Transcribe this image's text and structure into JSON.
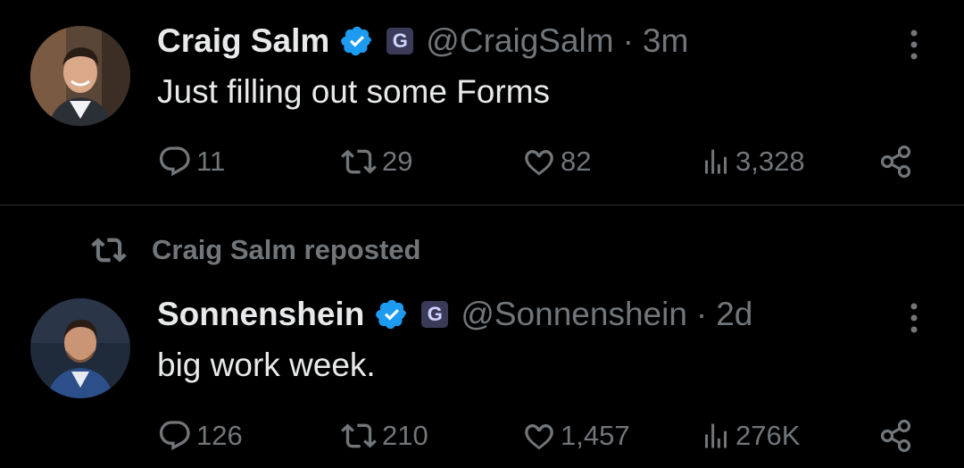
{
  "tweets": [
    {
      "name": "Craig Salm",
      "handle": "@CraigSalm",
      "dot": "·",
      "time": "3m",
      "text": "Just filling out some Forms",
      "replies": "11",
      "reposts": "29",
      "likes": "82",
      "views": "3,328"
    },
    {
      "repost_label": "Craig Salm reposted",
      "name": "Sonnenshein",
      "handle": "@Sonnenshein",
      "dot": "·",
      "time": "2d",
      "text": "big work week.",
      "replies": "126",
      "reposts": "210",
      "likes": "1,457",
      "views": "276K"
    }
  ],
  "badge_letter": "G",
  "colors": {
    "background": "#000000",
    "primary_text": "#e7e9ea",
    "secondary_text": "#71767b",
    "verified_blue": "#1d9bf0",
    "divider": "#2f3336"
  },
  "icons": [
    "verified-icon",
    "affiliate-badge-icon",
    "more-icon",
    "reply-icon",
    "repost-icon",
    "like-icon",
    "views-icon",
    "share-icon"
  ]
}
